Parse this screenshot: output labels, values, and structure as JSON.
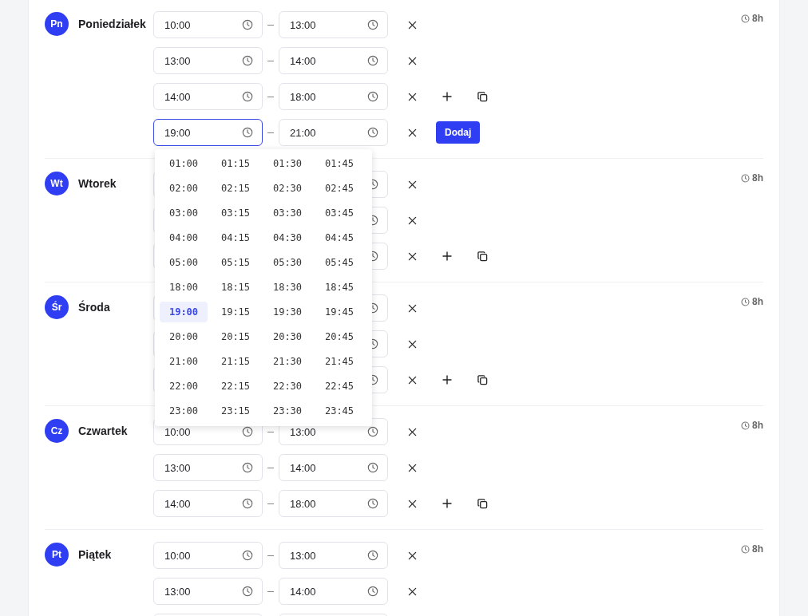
{
  "days": [
    {
      "abbr": "Pn",
      "name": "Poniedziałek",
      "hours": "8h",
      "slots": [
        {
          "start": "10:00",
          "end": "13:00",
          "focused": false,
          "add_copy": false
        },
        {
          "start": "13:00",
          "end": "14:00",
          "focused": false,
          "add_copy": false
        },
        {
          "start": "14:00",
          "end": "18:00",
          "focused": false,
          "add_copy": true
        },
        {
          "start": "19:00",
          "end": "21:00",
          "focused": true,
          "add_copy": false,
          "button": "Dodaj",
          "dropdown": {
            "options": [
              {
                "label": "01:00",
                "selected": false
              },
              {
                "label": "01:15",
                "selected": false
              },
              {
                "label": "01:30",
                "selected": false
              },
              {
                "label": "01:45",
                "selected": false
              },
              {
                "label": "02:00",
                "selected": false
              },
              {
                "label": "02:15",
                "selected": false
              },
              {
                "label": "02:30",
                "selected": false
              },
              {
                "label": "02:45",
                "selected": false
              },
              {
                "label": "03:00",
                "selected": false
              },
              {
                "label": "03:15",
                "selected": false
              },
              {
                "label": "03:30",
                "selected": false
              },
              {
                "label": "03:45",
                "selected": false
              },
              {
                "label": "04:00",
                "selected": false
              },
              {
                "label": "04:15",
                "selected": false
              },
              {
                "label": "04:30",
                "selected": false
              },
              {
                "label": "04:45",
                "selected": false
              },
              {
                "label": "05:00",
                "selected": false
              },
              {
                "label": "05:15",
                "selected": false
              },
              {
                "label": "05:30",
                "selected": false
              },
              {
                "label": "05:45",
                "selected": false
              },
              {
                "label": "18:00",
                "selected": false
              },
              {
                "label": "18:15",
                "selected": false
              },
              {
                "label": "18:30",
                "selected": false
              },
              {
                "label": "18:45",
                "selected": false
              },
              {
                "label": "19:00",
                "selected": true
              },
              {
                "label": "19:15",
                "selected": false
              },
              {
                "label": "19:30",
                "selected": false
              },
              {
                "label": "19:45",
                "selected": false
              },
              {
                "label": "20:00",
                "selected": false
              },
              {
                "label": "20:15",
                "selected": false
              },
              {
                "label": "20:30",
                "selected": false
              },
              {
                "label": "20:45",
                "selected": false
              },
              {
                "label": "21:00",
                "selected": false
              },
              {
                "label": "21:15",
                "selected": false
              },
              {
                "label": "21:30",
                "selected": false
              },
              {
                "label": "21:45",
                "selected": false
              },
              {
                "label": "22:00",
                "selected": false
              },
              {
                "label": "22:15",
                "selected": false
              },
              {
                "label": "22:30",
                "selected": false
              },
              {
                "label": "22:45",
                "selected": false
              },
              {
                "label": "23:00",
                "selected": false
              },
              {
                "label": "23:15",
                "selected": false
              },
              {
                "label": "23:30",
                "selected": false
              },
              {
                "label": "23:45",
                "selected": false
              }
            ]
          }
        }
      ]
    },
    {
      "abbr": "Wt",
      "name": "Wtorek",
      "hours": "8h",
      "slots": [
        {
          "focused": false,
          "add_copy": false
        },
        {
          "focused": false,
          "add_copy": false
        },
        {
          "focused": false,
          "add_copy": true
        }
      ]
    },
    {
      "abbr": "Śr",
      "name": "Środa",
      "hours": "8h",
      "slots": [
        {
          "focused": false,
          "add_copy": false
        },
        {
          "focused": false,
          "add_copy": false
        },
        {
          "focused": false,
          "add_copy": true
        }
      ]
    },
    {
      "abbr": "Cz",
      "name": "Czwartek",
      "hours": "8h",
      "slots": [
        {
          "start": "10:00",
          "end": "13:00",
          "focused": false,
          "add_copy": false
        },
        {
          "start": "13:00",
          "end": "14:00",
          "focused": false,
          "add_copy": false
        },
        {
          "start": "14:00",
          "end": "18:00",
          "focused": false,
          "add_copy": true
        }
      ]
    },
    {
      "abbr": "Pt",
      "name": "Piątek",
      "hours": "8h",
      "slots": [
        {
          "start": "10:00",
          "end": "13:00",
          "focused": false,
          "add_copy": false
        },
        {
          "start": "13:00",
          "end": "14:00",
          "focused": false,
          "add_copy": false
        },
        {
          "focused": false,
          "add_copy": false,
          "cut_off": true
        }
      ]
    }
  ]
}
